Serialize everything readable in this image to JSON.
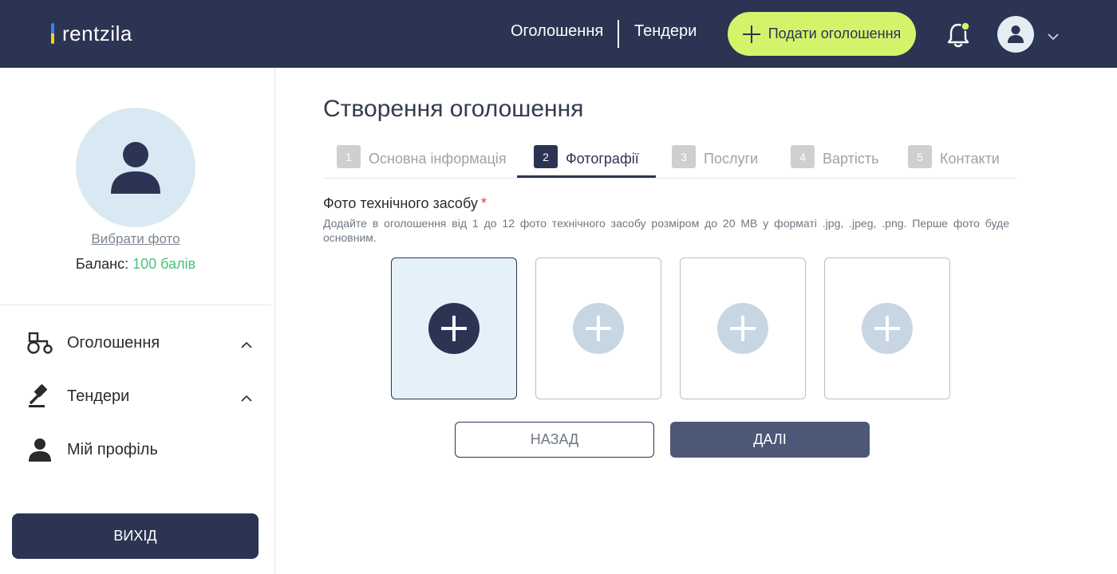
{
  "header": {
    "logo_text": "rentzila",
    "nav": [
      "Оголошення",
      "Тендери"
    ],
    "post_button": "Подати оголошення",
    "accent_color": "#d3f36b",
    "bg_color": "#2b3453"
  },
  "sidebar": {
    "choose_photo": "Вибрати фото",
    "balance_label": "Баланс:",
    "balance_value": "100 балів",
    "menu": [
      {
        "label": "Оголошення",
        "icon": "tractor-icon"
      },
      {
        "label": "Тендери",
        "icon": "gavel-icon"
      },
      {
        "label": "Мій профіль",
        "icon": "user-icon"
      }
    ],
    "logout": "Вихід"
  },
  "main": {
    "title": "Створення оголошення",
    "tabs": [
      {
        "num": "1",
        "label": "Основна інформація"
      },
      {
        "num": "2",
        "label": "Фотографії"
      },
      {
        "num": "3",
        "label": "Послуги"
      },
      {
        "num": "4",
        "label": "Вартість"
      },
      {
        "num": "5",
        "label": "Контакти"
      }
    ],
    "active_tab": 2,
    "field_label": "Фото технічного засобу",
    "required_mark": "*",
    "hint": "Додайте в оголошення від 1 до 12 фото технічного засобу розміром до 20 МВ у форматі .jpg, .jpeg, .png. Перше фото буде основним.",
    "back_button": "Назад",
    "next_button": "Далі"
  }
}
